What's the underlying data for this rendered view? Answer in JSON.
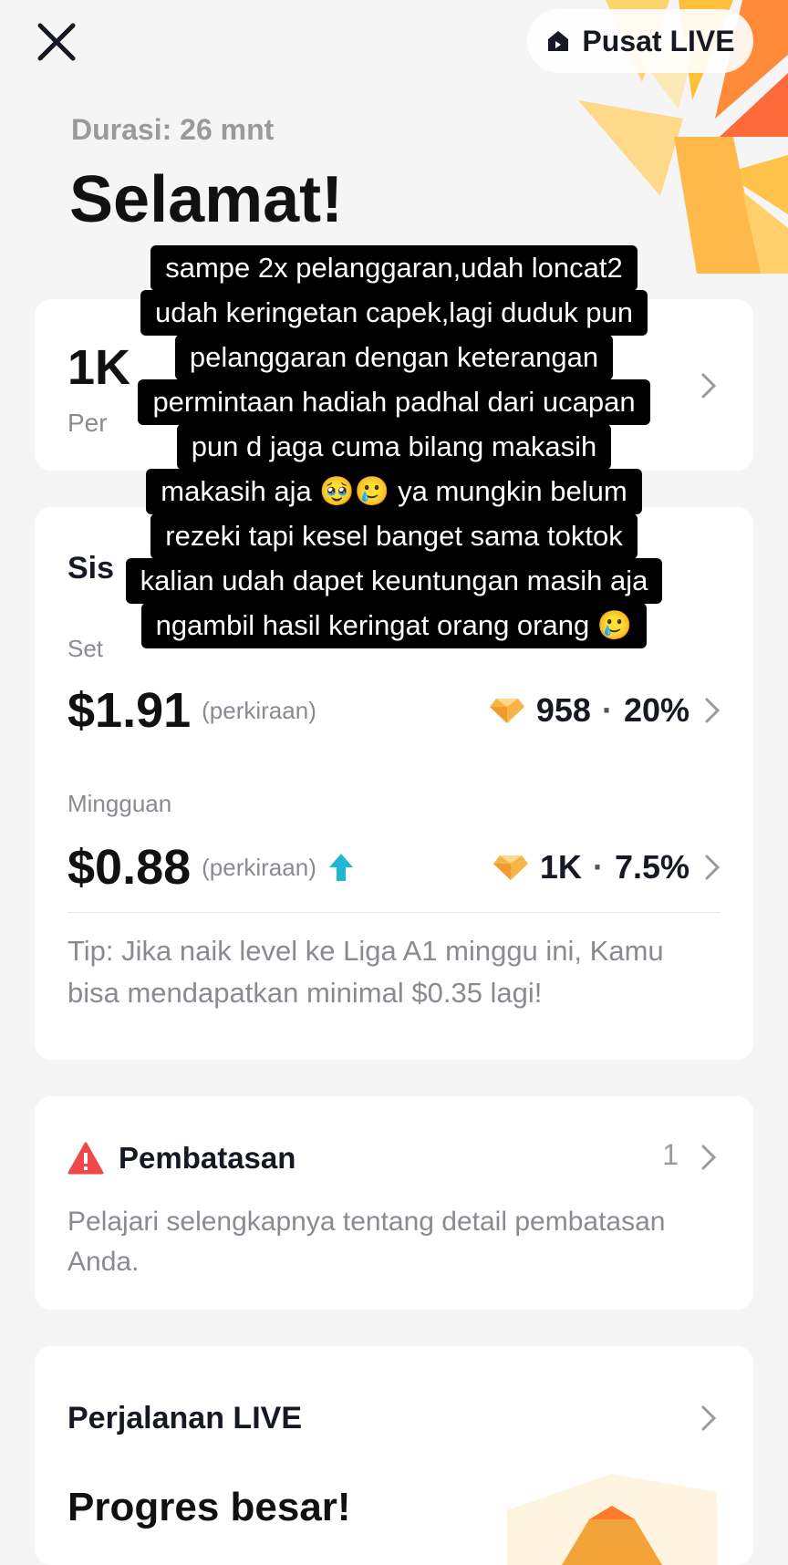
{
  "header": {
    "close_icon": "close-icon",
    "pusat_label": "Pusat LIVE",
    "pusat_icon": "home-icon",
    "duration": "Durasi: 26 mnt",
    "headline": "Selamat!"
  },
  "card_views": {
    "value": "1K",
    "subtitle": "Per"
  },
  "card_rewards": {
    "title": "Sis",
    "daily_label": "Set",
    "daily": {
      "amount": "$1.91",
      "estimate": "(perkiraan)",
      "diamonds": "958",
      "sep": "·",
      "percent": "20%"
    },
    "weekly_label": "Mingguan",
    "weekly": {
      "amount": "$0.88",
      "estimate": "(perkiraan)",
      "diamonds": "1K",
      "sep": "·",
      "percent": "7.5%"
    },
    "tip": "Tip: Jika naik level ke Liga A1 minggu ini, Kamu bisa mendapatkan minimal $0.35 lagi!"
  },
  "card_restrictions": {
    "title": "Pembatasan",
    "count": "1",
    "body": "Pelajari selengkapnya tentang detail pembatasan Anda."
  },
  "card_journey": {
    "title": "Perjalanan LIVE",
    "progress": "Progres besar!"
  },
  "overlay_caption": [
    "sampe 2x pelanggaran,udah loncat2",
    "udah keringetan capek,lagi duduk pun",
    "pelanggaran dengan keterangan",
    "permintaan hadiah padhal dari ucapan",
    "pun d jaga cuma bilang makasih",
    "makasih aja 🥹🥲 ya mungkin belum",
    "rezeki tapi kesel banget sama toktok",
    "kalian udah dapet keuntungan masih aja",
    "ngambil hasil keringat orang orang 🥲"
  ],
  "colors": {
    "accent_orange": "#f2a33a",
    "arrow_teal": "#1fb7d6",
    "warning_red": "#f04848"
  }
}
